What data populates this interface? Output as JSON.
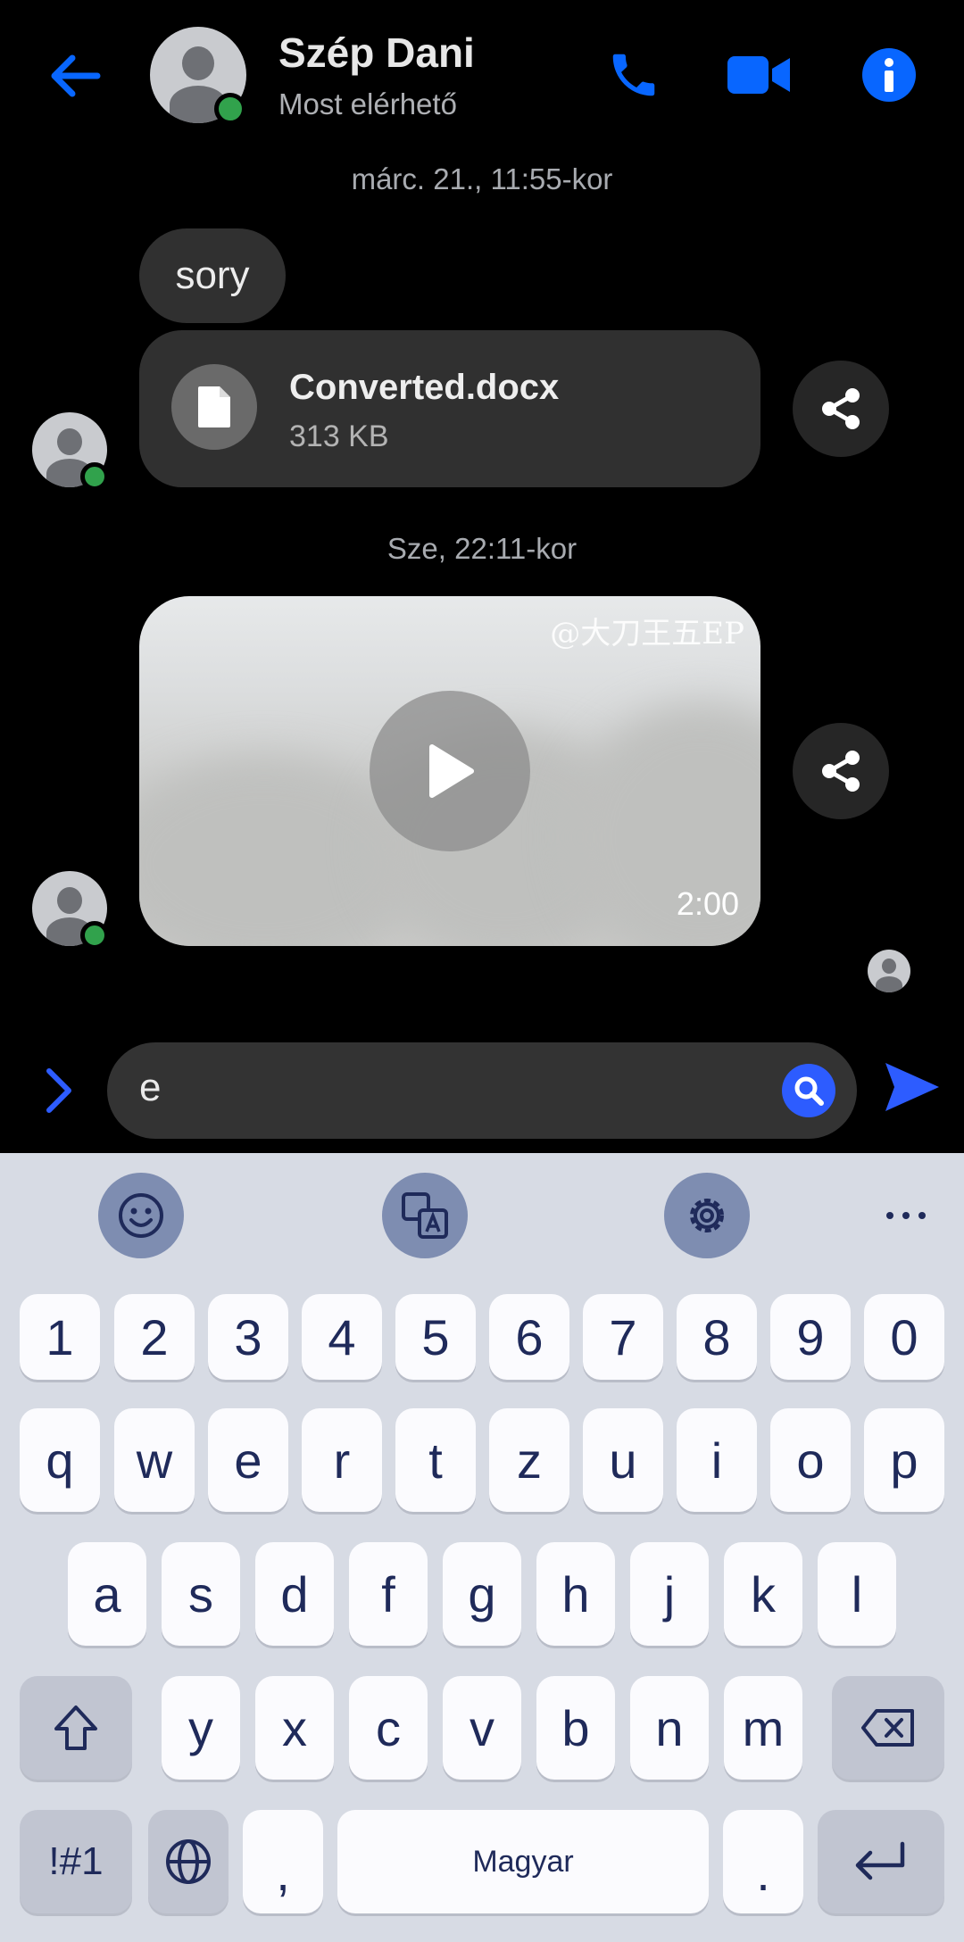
{
  "header": {
    "contact_name": "Szép Dani",
    "status": "Most elérhető",
    "icons": [
      "back-arrow-icon",
      "phone-icon",
      "video-call-icon",
      "info-icon"
    ]
  },
  "conversation": {
    "timestamp_1": "márc. 21., 11:55-kor",
    "message_text": "sory",
    "file": {
      "name": "Converted.docx",
      "size": "313 KB"
    },
    "timestamp_2": "Sze, 22:11-kor",
    "video": {
      "watermark": "@大刀王五EP",
      "duration": "2:00"
    }
  },
  "composer": {
    "value": "e"
  },
  "keyboard": {
    "language_label": "Magyar",
    "row_numbers": [
      "1",
      "2",
      "3",
      "4",
      "5",
      "6",
      "7",
      "8",
      "9",
      "0"
    ],
    "row_1": [
      "q",
      "w",
      "e",
      "r",
      "t",
      "z",
      "u",
      "i",
      "o",
      "p"
    ],
    "row_2": [
      "a",
      "s",
      "d",
      "f",
      "g",
      "h",
      "j",
      "k",
      "l"
    ],
    "row_3": [
      "y",
      "x",
      "c",
      "v",
      "b",
      "n",
      "m"
    ],
    "symbols_label": "!#1",
    "comma": ",",
    "period": "."
  },
  "colors": {
    "accent": "#0866ff",
    "online": "#31a24c",
    "bubble": "#303030",
    "keyboard_bg": "#d7dbe4",
    "key_text": "#1f2a5a"
  }
}
